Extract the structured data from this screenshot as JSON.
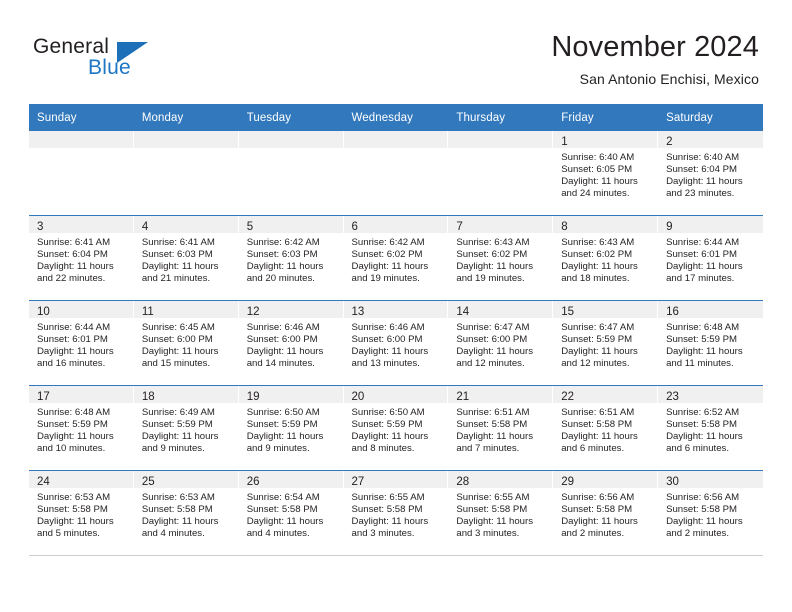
{
  "brand": {
    "name_top": "General",
    "name_bottom": "Blue",
    "flag_color": "#1d6fb8",
    "text_color": "#231f20",
    "blue_color": "#1d77c4"
  },
  "header": {
    "month_title": "November 2024",
    "location": "San Antonio Enchisi, Mexico"
  },
  "theme": {
    "header_blue": "#3278bd",
    "daynum_band": "#f0f0f0",
    "text": "#231f20",
    "border_gray": "#cdcdcd"
  },
  "calendar": {
    "weekday_headers": [
      "Sunday",
      "Monday",
      "Tuesday",
      "Wednesday",
      "Thursday",
      "Friday",
      "Saturday"
    ],
    "weeks": [
      [
        {
          "empty": true
        },
        {
          "empty": true
        },
        {
          "empty": true
        },
        {
          "empty": true
        },
        {
          "empty": true
        },
        {
          "day": "1",
          "sunrise": "Sunrise: 6:40 AM",
          "sunset": "Sunset: 6:05 PM",
          "daylight1": "Daylight: 11 hours",
          "daylight2": "and 24 minutes."
        },
        {
          "day": "2",
          "sunrise": "Sunrise: 6:40 AM",
          "sunset": "Sunset: 6:04 PM",
          "daylight1": "Daylight: 11 hours",
          "daylight2": "and 23 minutes."
        }
      ],
      [
        {
          "day": "3",
          "sunrise": "Sunrise: 6:41 AM",
          "sunset": "Sunset: 6:04 PM",
          "daylight1": "Daylight: 11 hours",
          "daylight2": "and 22 minutes."
        },
        {
          "day": "4",
          "sunrise": "Sunrise: 6:41 AM",
          "sunset": "Sunset: 6:03 PM",
          "daylight1": "Daylight: 11 hours",
          "daylight2": "and 21 minutes."
        },
        {
          "day": "5",
          "sunrise": "Sunrise: 6:42 AM",
          "sunset": "Sunset: 6:03 PM",
          "daylight1": "Daylight: 11 hours",
          "daylight2": "and 20 minutes."
        },
        {
          "day": "6",
          "sunrise": "Sunrise: 6:42 AM",
          "sunset": "Sunset: 6:02 PM",
          "daylight1": "Daylight: 11 hours",
          "daylight2": "and 19 minutes."
        },
        {
          "day": "7",
          "sunrise": "Sunrise: 6:43 AM",
          "sunset": "Sunset: 6:02 PM",
          "daylight1": "Daylight: 11 hours",
          "daylight2": "and 19 minutes."
        },
        {
          "day": "8",
          "sunrise": "Sunrise: 6:43 AM",
          "sunset": "Sunset: 6:02 PM",
          "daylight1": "Daylight: 11 hours",
          "daylight2": "and 18 minutes."
        },
        {
          "day": "9",
          "sunrise": "Sunrise: 6:44 AM",
          "sunset": "Sunset: 6:01 PM",
          "daylight1": "Daylight: 11 hours",
          "daylight2": "and 17 minutes."
        }
      ],
      [
        {
          "day": "10",
          "sunrise": "Sunrise: 6:44 AM",
          "sunset": "Sunset: 6:01 PM",
          "daylight1": "Daylight: 11 hours",
          "daylight2": "and 16 minutes."
        },
        {
          "day": "11",
          "sunrise": "Sunrise: 6:45 AM",
          "sunset": "Sunset: 6:00 PM",
          "daylight1": "Daylight: 11 hours",
          "daylight2": "and 15 minutes."
        },
        {
          "day": "12",
          "sunrise": "Sunrise: 6:46 AM",
          "sunset": "Sunset: 6:00 PM",
          "daylight1": "Daylight: 11 hours",
          "daylight2": "and 14 minutes."
        },
        {
          "day": "13",
          "sunrise": "Sunrise: 6:46 AM",
          "sunset": "Sunset: 6:00 PM",
          "daylight1": "Daylight: 11 hours",
          "daylight2": "and 13 minutes."
        },
        {
          "day": "14",
          "sunrise": "Sunrise: 6:47 AM",
          "sunset": "Sunset: 6:00 PM",
          "daylight1": "Daylight: 11 hours",
          "daylight2": "and 12 minutes."
        },
        {
          "day": "15",
          "sunrise": "Sunrise: 6:47 AM",
          "sunset": "Sunset: 5:59 PM",
          "daylight1": "Daylight: 11 hours",
          "daylight2": "and 12 minutes."
        },
        {
          "day": "16",
          "sunrise": "Sunrise: 6:48 AM",
          "sunset": "Sunset: 5:59 PM",
          "daylight1": "Daylight: 11 hours",
          "daylight2": "and 11 minutes."
        }
      ],
      [
        {
          "day": "17",
          "sunrise": "Sunrise: 6:48 AM",
          "sunset": "Sunset: 5:59 PM",
          "daylight1": "Daylight: 11 hours",
          "daylight2": "and 10 minutes."
        },
        {
          "day": "18",
          "sunrise": "Sunrise: 6:49 AM",
          "sunset": "Sunset: 5:59 PM",
          "daylight1": "Daylight: 11 hours",
          "daylight2": "and 9 minutes."
        },
        {
          "day": "19",
          "sunrise": "Sunrise: 6:50 AM",
          "sunset": "Sunset: 5:59 PM",
          "daylight1": "Daylight: 11 hours",
          "daylight2": "and 9 minutes."
        },
        {
          "day": "20",
          "sunrise": "Sunrise: 6:50 AM",
          "sunset": "Sunset: 5:59 PM",
          "daylight1": "Daylight: 11 hours",
          "daylight2": "and 8 minutes."
        },
        {
          "day": "21",
          "sunrise": "Sunrise: 6:51 AM",
          "sunset": "Sunset: 5:58 PM",
          "daylight1": "Daylight: 11 hours",
          "daylight2": "and 7 minutes."
        },
        {
          "day": "22",
          "sunrise": "Sunrise: 6:51 AM",
          "sunset": "Sunset: 5:58 PM",
          "daylight1": "Daylight: 11 hours",
          "daylight2": "and 6 minutes."
        },
        {
          "day": "23",
          "sunrise": "Sunrise: 6:52 AM",
          "sunset": "Sunset: 5:58 PM",
          "daylight1": "Daylight: 11 hours",
          "daylight2": "and 6 minutes."
        }
      ],
      [
        {
          "day": "24",
          "sunrise": "Sunrise: 6:53 AM",
          "sunset": "Sunset: 5:58 PM",
          "daylight1": "Daylight: 11 hours",
          "daylight2": "and 5 minutes."
        },
        {
          "day": "25",
          "sunrise": "Sunrise: 6:53 AM",
          "sunset": "Sunset: 5:58 PM",
          "daylight1": "Daylight: 11 hours",
          "daylight2": "and 4 minutes."
        },
        {
          "day": "26",
          "sunrise": "Sunrise: 6:54 AM",
          "sunset": "Sunset: 5:58 PM",
          "daylight1": "Daylight: 11 hours",
          "daylight2": "and 4 minutes."
        },
        {
          "day": "27",
          "sunrise": "Sunrise: 6:55 AM",
          "sunset": "Sunset: 5:58 PM",
          "daylight1": "Daylight: 11 hours",
          "daylight2": "and 3 minutes."
        },
        {
          "day": "28",
          "sunrise": "Sunrise: 6:55 AM",
          "sunset": "Sunset: 5:58 PM",
          "daylight1": "Daylight: 11 hours",
          "daylight2": "and 3 minutes."
        },
        {
          "day": "29",
          "sunrise": "Sunrise: 6:56 AM",
          "sunset": "Sunset: 5:58 PM",
          "daylight1": "Daylight: 11 hours",
          "daylight2": "and 2 minutes."
        },
        {
          "day": "30",
          "sunrise": "Sunrise: 6:56 AM",
          "sunset": "Sunset: 5:58 PM",
          "daylight1": "Daylight: 11 hours",
          "daylight2": "and 2 minutes."
        }
      ]
    ]
  }
}
